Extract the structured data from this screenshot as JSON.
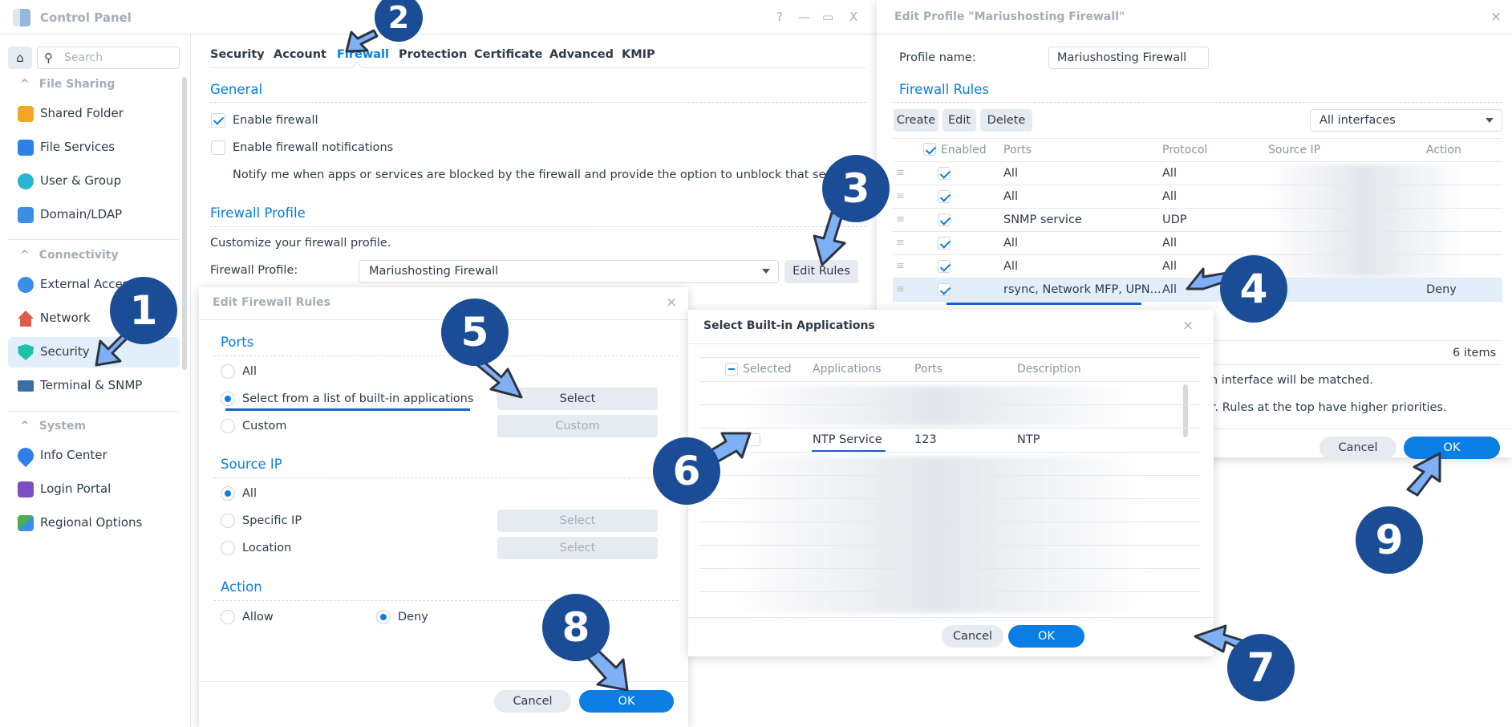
{
  "window": {
    "title": "Control Panel",
    "help": "?",
    "minimize": "—",
    "maximize": "▭",
    "close": "X"
  },
  "sidebar": {
    "search_placeholder": "Search",
    "sections": [
      {
        "label": "File Sharing",
        "items": [
          {
            "label": "Shared Folder",
            "icon": "shared-folder-icon",
            "color": "#f5a623"
          },
          {
            "label": "File Services",
            "icon": "file-services-icon",
            "color": "#2f7fe8"
          },
          {
            "label": "User & Group",
            "icon": "user-group-icon",
            "color": "#2bb3d6"
          },
          {
            "label": "Domain/LDAP",
            "icon": "domain-ldap-icon",
            "color": "#3a8ee6"
          }
        ]
      },
      {
        "label": "Connectivity",
        "items": [
          {
            "label": "External Access",
            "icon": "external-access-icon",
            "color": "#3a8ee6"
          },
          {
            "label": "Network",
            "icon": "network-icon",
            "color": "#e05a4a"
          },
          {
            "label": "Security",
            "icon": "security-shield-icon",
            "color": "#1fc0a8",
            "active": true
          },
          {
            "label": "Terminal & SNMP",
            "icon": "terminal-icon",
            "color": "#3a6ea8"
          }
        ]
      },
      {
        "label": "System",
        "items": [
          {
            "label": "Info Center",
            "icon": "info-center-icon",
            "color": "#2f7fe8"
          },
          {
            "label": "Login Portal",
            "icon": "login-portal-icon",
            "color": "#7b4fc2"
          },
          {
            "label": "Regional Options",
            "icon": "regional-options-icon",
            "color": "#4caf50"
          }
        ]
      }
    ]
  },
  "tabs": [
    "Security",
    "Account",
    "Firewall",
    "Protection",
    "Certificate",
    "Advanced",
    "KMIP"
  ],
  "active_tab": "Firewall",
  "general": {
    "heading": "General",
    "enable_firewall": {
      "label": "Enable firewall",
      "checked": true
    },
    "enable_notifications": {
      "label": "Enable firewall notifications",
      "checked": false
    },
    "notify_text": "Notify me when apps or services are blocked by the firewall and provide the option to unblock that service or app."
  },
  "firewall_profile": {
    "heading": "Firewall Profile",
    "desc": "Customize your firewall profile.",
    "label": "Firewall Profile:",
    "value": "Mariushosting Firewall",
    "edit_rules": "Edit Rules"
  },
  "edit_rules_dialog": {
    "title": "Edit Firewall Rules",
    "ports": {
      "heading": "Ports",
      "options": [
        "All",
        "Select from a list of built-in applications",
        "Custom"
      ],
      "selected": 1,
      "select_btn": "Select",
      "custom_btn": "Custom"
    },
    "source_ip": {
      "heading": "Source IP",
      "options": [
        "All",
        "Specific IP",
        "Location"
      ],
      "selected": 0,
      "select_btn": "Select"
    },
    "action": {
      "heading": "Action",
      "options": [
        "Allow",
        "Deny"
      ],
      "selected": 1
    },
    "cancel": "Cancel",
    "ok": "OK"
  },
  "edit_profile_dialog": {
    "title": "Edit Profile \"Mariushosting Firewall\"",
    "profile_name_label": "Profile name:",
    "profile_name_value": "Mariushosting Firewall",
    "rules_heading": "Firewall Rules",
    "buttons": {
      "create": "Create",
      "edit": "Edit",
      "delete": "Delete"
    },
    "interface_select": "All interfaces",
    "columns": [
      "Enabled",
      "Ports",
      "Protocol",
      "Source IP",
      "Action"
    ],
    "rows": [
      {
        "enabled": true,
        "ports": "All",
        "protocol": "All",
        "source_ip": "",
        "action": ""
      },
      {
        "enabled": true,
        "ports": "All",
        "protocol": "All",
        "source_ip": "",
        "action": ""
      },
      {
        "enabled": true,
        "ports": "SNMP service",
        "protocol": "UDP",
        "source_ip": "",
        "action": ""
      },
      {
        "enabled": true,
        "ports": "All",
        "protocol": "All",
        "source_ip": "",
        "action": ""
      },
      {
        "enabled": true,
        "ports": "All",
        "protocol": "All",
        "source_ip": "",
        "action": ""
      },
      {
        "enabled": true,
        "ports": "rsync, Network MFP, UPN...",
        "protocol": "All",
        "source_ip": "",
        "action": "Deny",
        "selected": true
      }
    ],
    "item_count": "6 items",
    "note1": "ch interface will be matched.",
    "note2": "er. Rules at the top have higher priorities.",
    "cancel": "Cancel",
    "ok": "OK"
  },
  "select_apps_dialog": {
    "title": "Select Built-in Applications",
    "columns": [
      "Selected",
      "Applications",
      "Ports",
      "Description"
    ],
    "highlight_row": {
      "application": "NTP Service",
      "ports": "123",
      "description": "NTP",
      "checked": false
    },
    "cancel": "Cancel",
    "ok": "OK"
  },
  "annotations": [
    "1",
    "2",
    "3",
    "4",
    "5",
    "6",
    "7",
    "8",
    "9"
  ]
}
